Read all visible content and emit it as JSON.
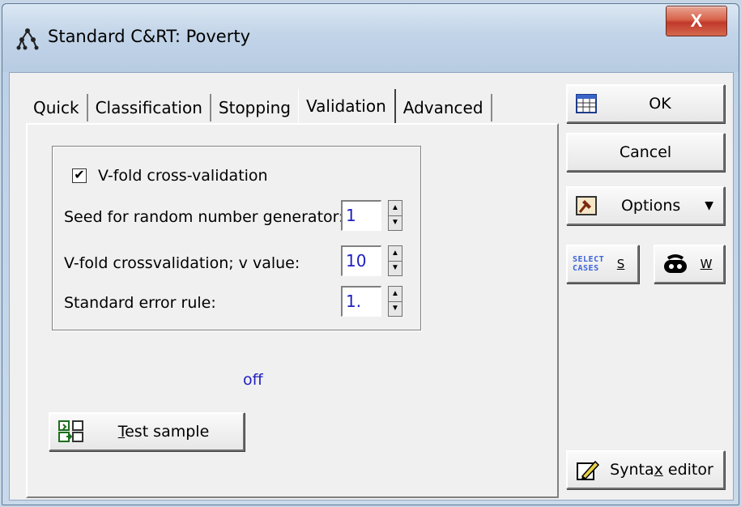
{
  "window": {
    "title": "Standard C&RT: Poverty",
    "close_label": "X"
  },
  "tabs": [
    {
      "label": "Quick",
      "active": false
    },
    {
      "label": "Classification",
      "active": false
    },
    {
      "label": "Stopping",
      "active": false
    },
    {
      "label": "Validation",
      "active": true
    },
    {
      "label": "Advanced",
      "active": false
    }
  ],
  "validation": {
    "vfold_checkbox": {
      "label": "V-fold cross-validation",
      "checked": true,
      "mark": "✔"
    },
    "seed": {
      "label": "Seed for random number generator:",
      "value": "1"
    },
    "v_value": {
      "label": "V-fold crossvalidation; v value:",
      "value": "10"
    },
    "se_rule": {
      "label": "Standard error rule:",
      "value": "1."
    },
    "test_sample": {
      "label_first": "T",
      "label_rest": "est sample",
      "status": "off"
    }
  },
  "sidebar": {
    "ok_label": "OK",
    "cancel_label": "Cancel",
    "options_label": "Options",
    "select_cases": {
      "icon_text_1": "SELECT",
      "icon_text_2": "CASES",
      "shortcut": "S"
    },
    "weights": {
      "shortcut": "W"
    },
    "syntax_editor": {
      "label_pre": "Synta",
      "label_u": "x",
      "label_post": " editor"
    }
  },
  "colors": {
    "accent_blue": "#1f1fbf",
    "close_red": "#c1392b"
  }
}
